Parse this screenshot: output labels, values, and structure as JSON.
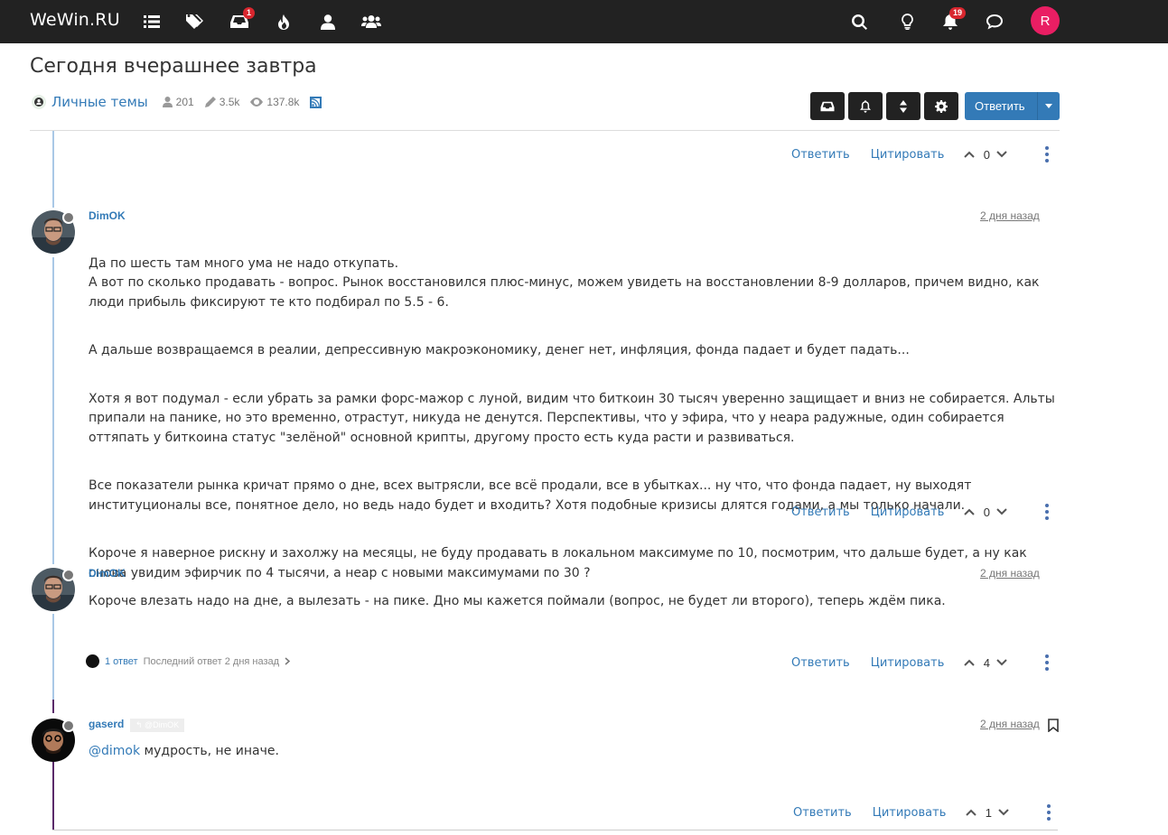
{
  "brand": "WeWin.RU",
  "nav": {
    "unread_badge": "1",
    "notifications_badge": "19",
    "user_initial": "R"
  },
  "topic": {
    "title": "Сегодня вчерашнее завтра",
    "category": "Личные темы",
    "posters": "201",
    "posts": "3.5k",
    "views": "137.8k"
  },
  "toolbar": {
    "reply_label": "Ответить"
  },
  "post_actions": {
    "reply": "Ответить",
    "quote": "Цитировать"
  },
  "posts": [
    {
      "votes": "0"
    },
    {
      "author": "DimOK",
      "time": "2 дня назад",
      "paragraphs": [
        "Да по шесть там много ума не надо откупать.\nА вот по сколько продавать - вопрос. Рынок восстановился плюс-минус, можем увидеть на восстановлении 8-9 долларов, причем видно, как люди прибыль фиксируют те кто подбирал по 5.5 - 6.",
        "А дальше возвращаемся в реалии, депрессивную макроэкономику, денег нет, инфляция, фонда падает и будет падать...",
        "Хотя я вот подумал - если убрать за рамки форс-мажор с луной, видим что биткоин 30 тысяч уверенно защищает и вниз не собирается. Альты припали на панике, но это временно, отрастут, никуда не денутся. Перспективы, что у эфира, что у неара радужные, один собирается оттяпать у биткоина статус \"зелёной\" основной крипты, другому просто есть куда расти и развиваться.",
        "Все показатели рынка кричат прямо о дне, всех вытрясли, все всё продали, все в убытках... ну что, что фонда падает, ну выходят институционалы все, понятное дело, но ведь надо будет и входить? Хотя подобные кризисы длятся годами, а мы только начали.",
        "Короче я наверное рискну и захолжу на месяцы, не буду продавать в локальном максимуме по 10, посмотрим, что дальше будет, а ну как снова увидим эфирчик по 4 тысячи, а неар с новыми максимумами по 30 ?"
      ],
      "votes": "0"
    },
    {
      "author": "DimOK",
      "time": "2 дня назад",
      "text": "Короче влезать надо на дне, а вылезать - на пике. Дно мы кажется поймали (вопрос, не будет ли второго), теперь ждём пика.",
      "replies_count": "1 ответ",
      "replies_last": "Последний ответ 2 дня назад",
      "votes": "4"
    },
    {
      "author": "gaserd",
      "parent_tag": "@DimOK",
      "time": "2 дня назад",
      "mention": "@dimok",
      "text": " мудрость, не иначе.",
      "votes": "1"
    }
  ]
}
